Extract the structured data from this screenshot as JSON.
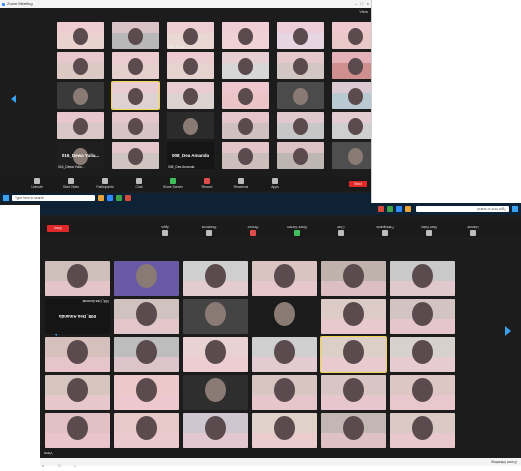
{
  "top_window": {
    "title": "Zoom Meeting",
    "view_label": "View",
    "top_right_label": "",
    "participants": [
      {
        "name": "",
        "bg": "#ead3cf"
      },
      {
        "name": "",
        "bg": "#b8b8b8"
      },
      {
        "name": "006_Zahra",
        "bg": "#e9d7d3"
      },
      {
        "name": "",
        "bg": "#efd2d6"
      },
      {
        "name": "",
        "bg": "#e7d5e1"
      },
      {
        "name": "",
        "bg": "#ebc8c8"
      },
      {
        "name": "",
        "bg": "#dcc9c3"
      },
      {
        "name": "",
        "bg": "#e6cfcd"
      },
      {
        "name": "",
        "bg": "#e6d2cf"
      },
      {
        "name": "",
        "bg": "#d7d7d7"
      },
      {
        "name": "",
        "bg": "#d2c7c2"
      },
      {
        "name": "",
        "bg": "#cf8f8f"
      },
      {
        "name": "",
        "bg": "#3a3a3a"
      },
      {
        "name": "",
        "bg": "#ddd1d1"
      },
      {
        "name": "",
        "bg": "#dcd2cf"
      },
      {
        "name": "",
        "bg": "#ebc4c7"
      },
      {
        "name": "",
        "bg": "#4b4b4b"
      },
      {
        "name": "",
        "bg": "#b9c9d2"
      },
      {
        "name": "",
        "bg": "#d9c6c6"
      },
      {
        "name": "",
        "bg": "#d8c4c8"
      },
      {
        "name": "",
        "bg": "#2b2b2b"
      },
      {
        "name": "",
        "bg": "#d0c0c0"
      },
      {
        "name": "",
        "bg": "#c7c7c7"
      },
      {
        "name": "",
        "bg": "#cfcfcf"
      },
      {
        "name": "016_Dewa Yulia...",
        "bg": "#1f1f1f"
      },
      {
        "name": "",
        "bg": "#cfc4c0"
      },
      {
        "name": "008_Dea Amanda",
        "bg": "#151515"
      },
      {
        "name": "",
        "bg": "#cdbebc"
      },
      {
        "name": "",
        "bg": "#bdb6b2"
      },
      {
        "name": "",
        "bg": "#4e4e4e"
      }
    ],
    "toolbar": [
      {
        "label": "Unmute"
      },
      {
        "label": "Start Video"
      },
      {
        "label": "Participants"
      },
      {
        "label": "Chat"
      },
      {
        "label": "Share Screen"
      },
      {
        "label": "Record"
      },
      {
        "label": "Reactions"
      },
      {
        "label": "Apps"
      }
    ],
    "end_label": "End",
    "search_placeholder": "Type here to search",
    "time": "",
    "date": ""
  },
  "bottom_window": {
    "participants": [
      {
        "name": "",
        "bg": "#dbc9c6"
      },
      {
        "name": "",
        "bg": "#c2b7b2"
      },
      {
        "name": "",
        "bg": "#e0d2c9"
      },
      {
        "name": "",
        "bg": "#cfc7cf"
      },
      {
        "name": "",
        "bg": "#e7c9ca"
      },
      {
        "name": "",
        "bg": "#e2c0c4"
      },
      {
        "name": "",
        "bg": "#dcc7c4"
      },
      {
        "name": "",
        "bg": "#dac5c5"
      },
      {
        "name": "",
        "bg": "#d8c4c1"
      },
      {
        "name": "",
        "bg": "#2e2e2e"
      },
      {
        "name": "",
        "bg": "#ecc8cb"
      },
      {
        "name": "",
        "bg": "#d7c5c0"
      },
      {
        "name": "",
        "bg": "#d7d1cd"
      },
      {
        "name": "",
        "bg": "#dccfc8"
      },
      {
        "name": "",
        "bg": "#cfcfcf"
      },
      {
        "name": "",
        "bg": "#e9d3d2"
      },
      {
        "name": "",
        "bg": "#bdbdbd"
      },
      {
        "name": "",
        "bg": "#d6c0be"
      },
      {
        "name": "",
        "bg": "#d3c3c3"
      },
      {
        "name": "",
        "bg": "#dccbc7"
      },
      {
        "name": "",
        "bg": "#1b1b1b"
      },
      {
        "name": "",
        "bg": "#444444"
      },
      {
        "name": "",
        "bg": "#d0c2be"
      },
      {
        "name": "008_Dea Amanda",
        "bg": "#151515"
      },
      {
        "name": "",
        "bg": "#c9c9c9"
      },
      {
        "name": "",
        "bg": "#bfb2ad"
      },
      {
        "name": "",
        "bg": "#d9c4c2"
      },
      {
        "name": "",
        "bg": "#cfcfcf"
      },
      {
        "name": "",
        "bg": "#6a5aa6"
      },
      {
        "name": "",
        "bg": "#cfbfbb"
      }
    ],
    "toolbar": [
      {
        "label": "Unmute"
      },
      {
        "label": "Start Video"
      },
      {
        "label": "Participants"
      },
      {
        "label": "Chat"
      },
      {
        "label": "Share Screen"
      },
      {
        "label": "Record"
      },
      {
        "label": "Reactions"
      },
      {
        "label": "Apps"
      }
    ],
    "end_label": "End",
    "search_placeholder": "Type here to search",
    "view_label": "View",
    "time": "",
    "date": ""
  },
  "colors": {
    "zoom_bg": "#1c1c1c",
    "active_speaker": "#f2d54a",
    "end_red": "#e02828",
    "arrow_blue": "#3aa0f0",
    "taskbar": "#0e2236"
  },
  "footer": {
    "title": "Zoom Meeting"
  }
}
